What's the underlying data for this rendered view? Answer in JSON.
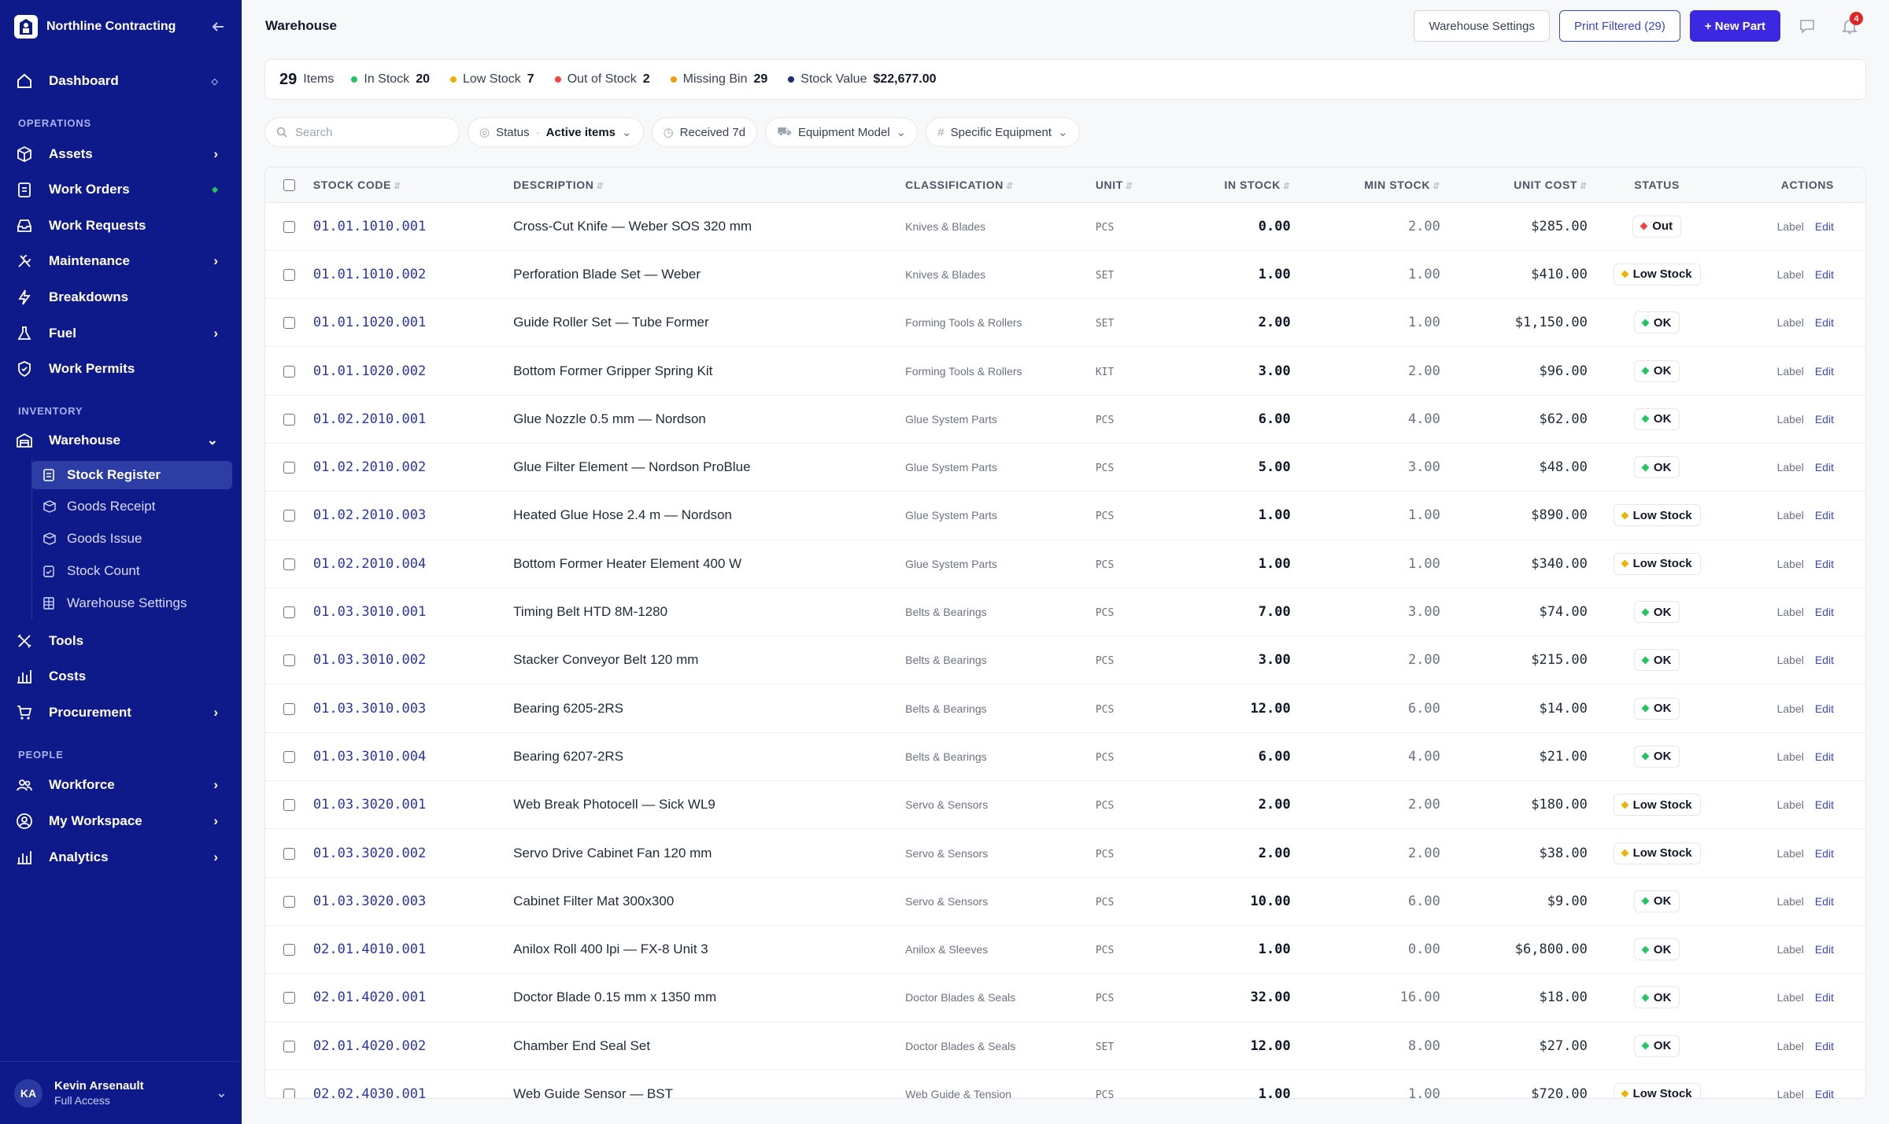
{
  "app": {
    "company": "Northline Contracting",
    "page_title": "Warehouse"
  },
  "sidebar": {
    "dashboard": "Dashboard",
    "sections": {
      "operations": "OPERATIONS",
      "inventory": "INVENTORY",
      "people": "PEOPLE"
    },
    "operations": [
      "Assets",
      "Work Orders",
      "Work Requests",
      "Maintenance",
      "Breakdowns",
      "Fuel",
      "Work Permits"
    ],
    "warehouse": "Warehouse",
    "warehouse_items": [
      "Stock Register",
      "Goods Receipt",
      "Goods Issue",
      "Stock Count",
      "Warehouse Settings"
    ],
    "inventory_more": [
      "Tools",
      "Costs",
      "Procurement"
    ],
    "people": [
      "Workforce",
      "My Workspace",
      "Analytics"
    ],
    "user": {
      "initials": "KA",
      "name": "Kevin Arsenault",
      "role": "Full Access"
    }
  },
  "header": {
    "settings_button": "Warehouse Settings",
    "print_button": "Print Filtered (29)",
    "new_button": "+ New Part",
    "notification_count": "4"
  },
  "stats": {
    "items_count": "29",
    "items_label": "Items",
    "in_stock_label": "In Stock",
    "in_stock": "20",
    "low_stock_label": "Low Stock",
    "low_stock": "7",
    "out_label": "Out of Stock",
    "out": "2",
    "missing_bin_label": "Missing Bin",
    "missing_bin": "29",
    "value_label": "Stock Value",
    "value": "$22,677.00",
    "colors": {
      "in_stock": "#22c55e",
      "low": "#eab308",
      "out": "#ef4444",
      "missing": "#f59e0b",
      "value": "#1e2a78"
    }
  },
  "filters": {
    "search_placeholder": "Search",
    "status_label": "Status",
    "status_value": "Active items",
    "received": "Received 7d",
    "equipment_model": "Equipment Model",
    "specific_equipment": "Specific Equipment"
  },
  "table": {
    "headers": {
      "code": "STOCK CODE",
      "description": "DESCRIPTION",
      "classification": "CLASSIFICATION",
      "unit": "UNIT",
      "in_stock": "IN STOCK",
      "min_stock": "MIN STOCK",
      "unit_cost": "UNIT COST",
      "status": "STATUS",
      "actions": "ACTIONS"
    },
    "action_label": "Label",
    "action_edit": "Edit",
    "rows": [
      {
        "code": "01.01.1010.001",
        "desc": "Cross-Cut Knife — Weber SOS 320 mm",
        "cls": "Knives & Blades",
        "unit": "PCS",
        "in": "0.00",
        "min": "2.00",
        "cost": "$285.00",
        "status": "Out"
      },
      {
        "code": "01.01.1010.002",
        "desc": "Perforation Blade Set — Weber",
        "cls": "Knives & Blades",
        "unit": "SET",
        "in": "1.00",
        "min": "1.00",
        "cost": "$410.00",
        "status": "Low Stock"
      },
      {
        "code": "01.01.1020.001",
        "desc": "Guide Roller Set — Tube Former",
        "cls": "Forming Tools & Rollers",
        "unit": "SET",
        "in": "2.00",
        "min": "1.00",
        "cost": "$1,150.00",
        "status": "OK"
      },
      {
        "code": "01.01.1020.002",
        "desc": "Bottom Former Gripper Spring Kit",
        "cls": "Forming Tools & Rollers",
        "unit": "KIT",
        "in": "3.00",
        "min": "2.00",
        "cost": "$96.00",
        "status": "OK"
      },
      {
        "code": "01.02.2010.001",
        "desc": "Glue Nozzle 0.5 mm — Nordson",
        "cls": "Glue System Parts",
        "unit": "PCS",
        "in": "6.00",
        "min": "4.00",
        "cost": "$62.00",
        "status": "OK"
      },
      {
        "code": "01.02.2010.002",
        "desc": "Glue Filter Element — Nordson ProBlue",
        "cls": "Glue System Parts",
        "unit": "PCS",
        "in": "5.00",
        "min": "3.00",
        "cost": "$48.00",
        "status": "OK"
      },
      {
        "code": "01.02.2010.003",
        "desc": "Heated Glue Hose 2.4 m — Nordson",
        "cls": "Glue System Parts",
        "unit": "PCS",
        "in": "1.00",
        "min": "1.00",
        "cost": "$890.00",
        "status": "Low Stock"
      },
      {
        "code": "01.02.2010.004",
        "desc": "Bottom Former Heater Element 400 W",
        "cls": "Glue System Parts",
        "unit": "PCS",
        "in": "1.00",
        "min": "1.00",
        "cost": "$340.00",
        "status": "Low Stock"
      },
      {
        "code": "01.03.3010.001",
        "desc": "Timing Belt HTD 8M-1280",
        "cls": "Belts & Bearings",
        "unit": "PCS",
        "in": "7.00",
        "min": "3.00",
        "cost": "$74.00",
        "status": "OK"
      },
      {
        "code": "01.03.3010.002",
        "desc": "Stacker Conveyor Belt 120 mm",
        "cls": "Belts & Bearings",
        "unit": "PCS",
        "in": "3.00",
        "min": "2.00",
        "cost": "$215.00",
        "status": "OK"
      },
      {
        "code": "01.03.3010.003",
        "desc": "Bearing 6205-2RS",
        "cls": "Belts & Bearings",
        "unit": "PCS",
        "in": "12.00",
        "min": "6.00",
        "cost": "$14.00",
        "status": "OK"
      },
      {
        "code": "01.03.3010.004",
        "desc": "Bearing 6207-2RS",
        "cls": "Belts & Bearings",
        "unit": "PCS",
        "in": "6.00",
        "min": "4.00",
        "cost": "$21.00",
        "status": "OK"
      },
      {
        "code": "01.03.3020.001",
        "desc": "Web Break Photocell — Sick WL9",
        "cls": "Servo & Sensors",
        "unit": "PCS",
        "in": "2.00",
        "min": "2.00",
        "cost": "$180.00",
        "status": "Low Stock"
      },
      {
        "code": "01.03.3020.002",
        "desc": "Servo Drive Cabinet Fan 120 mm",
        "cls": "Servo & Sensors",
        "unit": "PCS",
        "in": "2.00",
        "min": "2.00",
        "cost": "$38.00",
        "status": "Low Stock"
      },
      {
        "code": "01.03.3020.003",
        "desc": "Cabinet Filter Mat 300x300",
        "cls": "Servo & Sensors",
        "unit": "PCS",
        "in": "10.00",
        "min": "6.00",
        "cost": "$9.00",
        "status": "OK"
      },
      {
        "code": "02.01.4010.001",
        "desc": "Anilox Roll 400 lpi — FX-8 Unit 3",
        "cls": "Anilox & Sleeves",
        "unit": "PCS",
        "in": "1.00",
        "min": "0.00",
        "cost": "$6,800.00",
        "status": "OK"
      },
      {
        "code": "02.01.4020.001",
        "desc": "Doctor Blade 0.15 mm x 1350 mm",
        "cls": "Doctor Blades & Seals",
        "unit": "PCS",
        "in": "32.00",
        "min": "16.00",
        "cost": "$18.00",
        "status": "OK"
      },
      {
        "code": "02.01.4020.002",
        "desc": "Chamber End Seal Set",
        "cls": "Doctor Blades & Seals",
        "unit": "SET",
        "in": "12.00",
        "min": "8.00",
        "cost": "$27.00",
        "status": "OK"
      },
      {
        "code": "02.02.4030.001",
        "desc": "Web Guide Sensor — BST",
        "cls": "Web Guide & Tension",
        "unit": "PCS",
        "in": "1.00",
        "min": "1.00",
        "cost": "$720.00",
        "status": "Low Stock"
      }
    ],
    "status_colors": {
      "OK": "#22c55e",
      "Low Stock": "#eab308",
      "Out": "#ef4444"
    }
  }
}
